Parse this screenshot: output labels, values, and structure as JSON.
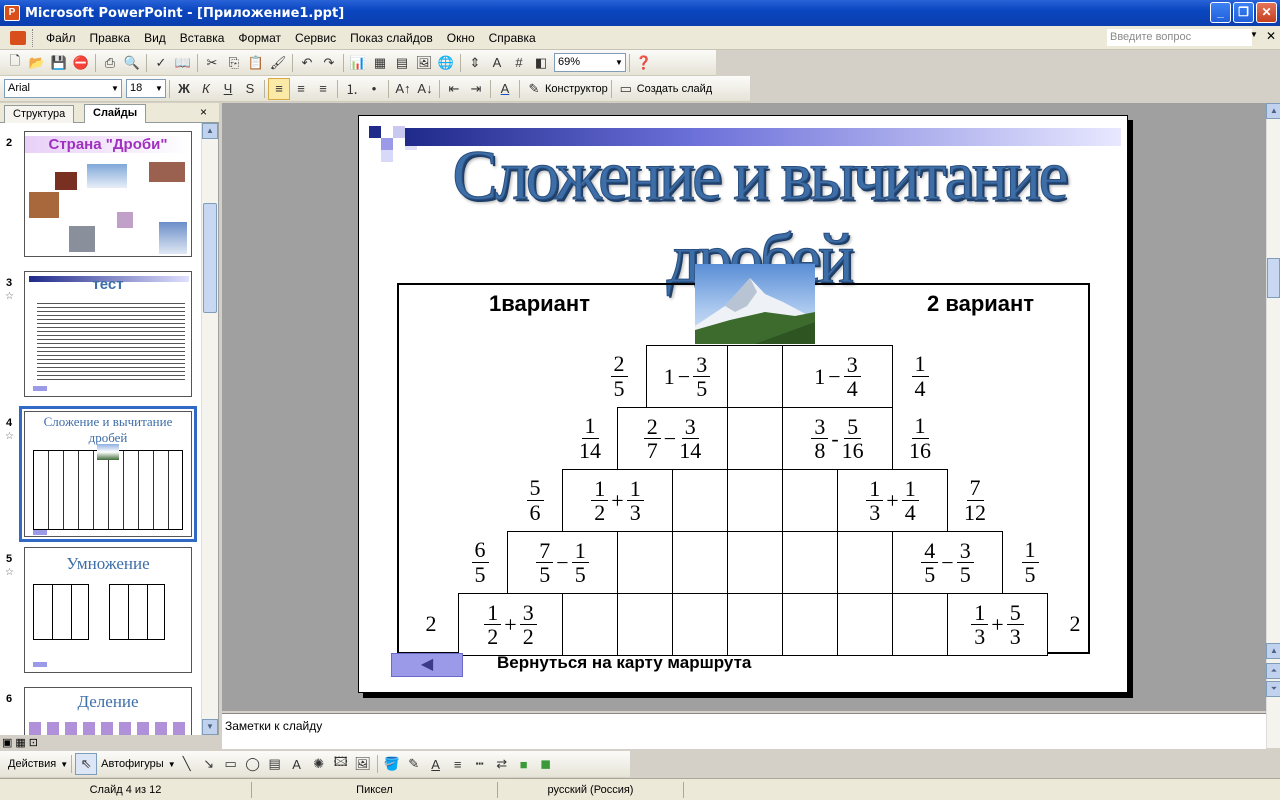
{
  "window": {
    "title": "Microsoft PowerPoint - [Приложение1.ppt]",
    "app_icon": "powerpoint-icon"
  },
  "menu": {
    "items": [
      "Файл",
      "Правка",
      "Вид",
      "Вставка",
      "Формат",
      "Сервис",
      "Показ слайдов",
      "Окно",
      "Справка"
    ],
    "ask_placeholder": "Введите вопрос"
  },
  "toolbar": {
    "zoom": "69%"
  },
  "formatting": {
    "font": "Arial",
    "size": "18",
    "designer": "Конструктор",
    "new_slide": "Создать слайд"
  },
  "panel": {
    "tabs": [
      "Структура",
      "Слайды"
    ],
    "close": "×"
  },
  "thumbnails": [
    {
      "num": "2",
      "title": "Страна \"Дроби\""
    },
    {
      "num": "3",
      "title": "тест"
    },
    {
      "num": "4",
      "title": "Сложение и вычитание дробей"
    },
    {
      "num": "5",
      "title": "Умножение"
    },
    {
      "num": "6",
      "title": "Деление"
    }
  ],
  "slide": {
    "title": "Сложение и вычитание дробей",
    "variant1": "1вариант",
    "variant2": "2 вариант",
    "back_label": "Вернуться на карту маршрута",
    "rows": [
      {
        "left": {
          "n": "2",
          "d": "5"
        },
        "lcell": {
          "whole": "1",
          "op": "−",
          "n": "3",
          "d": "5"
        },
        "rcell": {
          "whole": "1",
          "op": "−",
          "n": "3",
          "d": "4"
        },
        "right": {
          "n": "1",
          "d": "4"
        }
      },
      {
        "left": {
          "n": "1",
          "d": "14"
        },
        "lcell": {
          "n1": "2",
          "d1": "7",
          "op": "−",
          "n2": "3",
          "d2": "14"
        },
        "rcell": {
          "n1": "3",
          "d1": "8",
          "op": "-",
          "n2": "5",
          "d2": "16"
        },
        "right": {
          "n": "1",
          "d": "16"
        }
      },
      {
        "left": {
          "n": "5",
          "d": "6"
        },
        "lcell": {
          "n1": "1",
          "d1": "2",
          "op": "+",
          "n2": "1",
          "d2": "3"
        },
        "rcell": {
          "n1": "1",
          "d1": "3",
          "op": "+",
          "n2": "1",
          "d2": "4"
        },
        "right": {
          "n": "7",
          "d": "12"
        }
      },
      {
        "left": {
          "n": "6",
          "d": "5"
        },
        "lcell": {
          "n1": "7",
          "d1": "5",
          "op": "−",
          "n2": "1",
          "d2": "5"
        },
        "rcell": {
          "n1": "4",
          "d1": "5",
          "op": "−",
          "n2": "3",
          "d2": "5"
        },
        "right": {
          "n": "1",
          "d": "5"
        }
      },
      {
        "left": {
          "n": "2"
        },
        "lcell": {
          "n1": "1",
          "d1": "2",
          "op": "+",
          "n2": "3",
          "d2": "2"
        },
        "rcell": {
          "n1": "1",
          "d1": "3",
          "op": "+",
          "n2": "5",
          "d2": "3"
        },
        "right": {
          "n": "2"
        }
      }
    ]
  },
  "notes": {
    "placeholder": "Заметки к слайду"
  },
  "drawing": {
    "actions": "Действия",
    "autoshapes": "Автофигуры"
  },
  "status": {
    "slide": "Слайд 4 из 12",
    "design": "Пиксел",
    "language": "русский (Россия)"
  },
  "colors": {
    "title_blue": "#3d6ea8",
    "title_bar": "#1f2a8a",
    "accent_purple": "#9a9ae8",
    "xp_blue": "#0a46c0"
  }
}
